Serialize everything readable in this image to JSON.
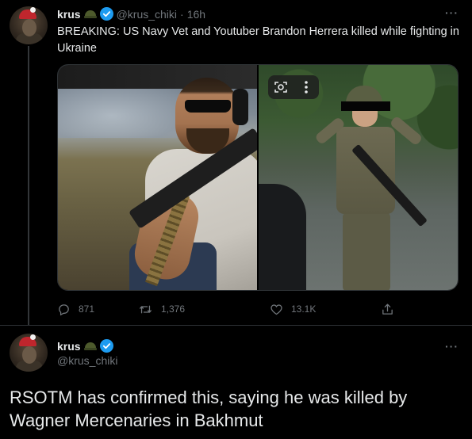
{
  "tweet1": {
    "display_name": "krus",
    "handle": "@krus_chiki",
    "separator": "·",
    "time": "16h",
    "text": "BREAKING: US Navy Vet and Youtuber Brandon Herrera killed while fighting in Ukraine",
    "more": "···",
    "actions": {
      "reply_count": "871",
      "retweet_count": "1,376",
      "like_count": "13.1K"
    }
  },
  "tweet2": {
    "display_name": "krus",
    "handle": "@krus_chiki",
    "more": "···",
    "text": "RSOTM has confirmed this, saying he was killed by Wagner Mercenaries in Bakhmut"
  },
  "colors": {
    "background": "#000000",
    "text": "#e7e9ea",
    "muted": "#71767b",
    "verified": "#1d9bf0",
    "border": "#2f3336"
  },
  "icons": {
    "reply": "comment-icon",
    "retweet": "retweet-icon",
    "like": "heart-icon",
    "share": "share-icon",
    "lens": "google-lens-icon",
    "media_more": "vertical-dots-icon",
    "verified": "verified-badge-icon"
  }
}
